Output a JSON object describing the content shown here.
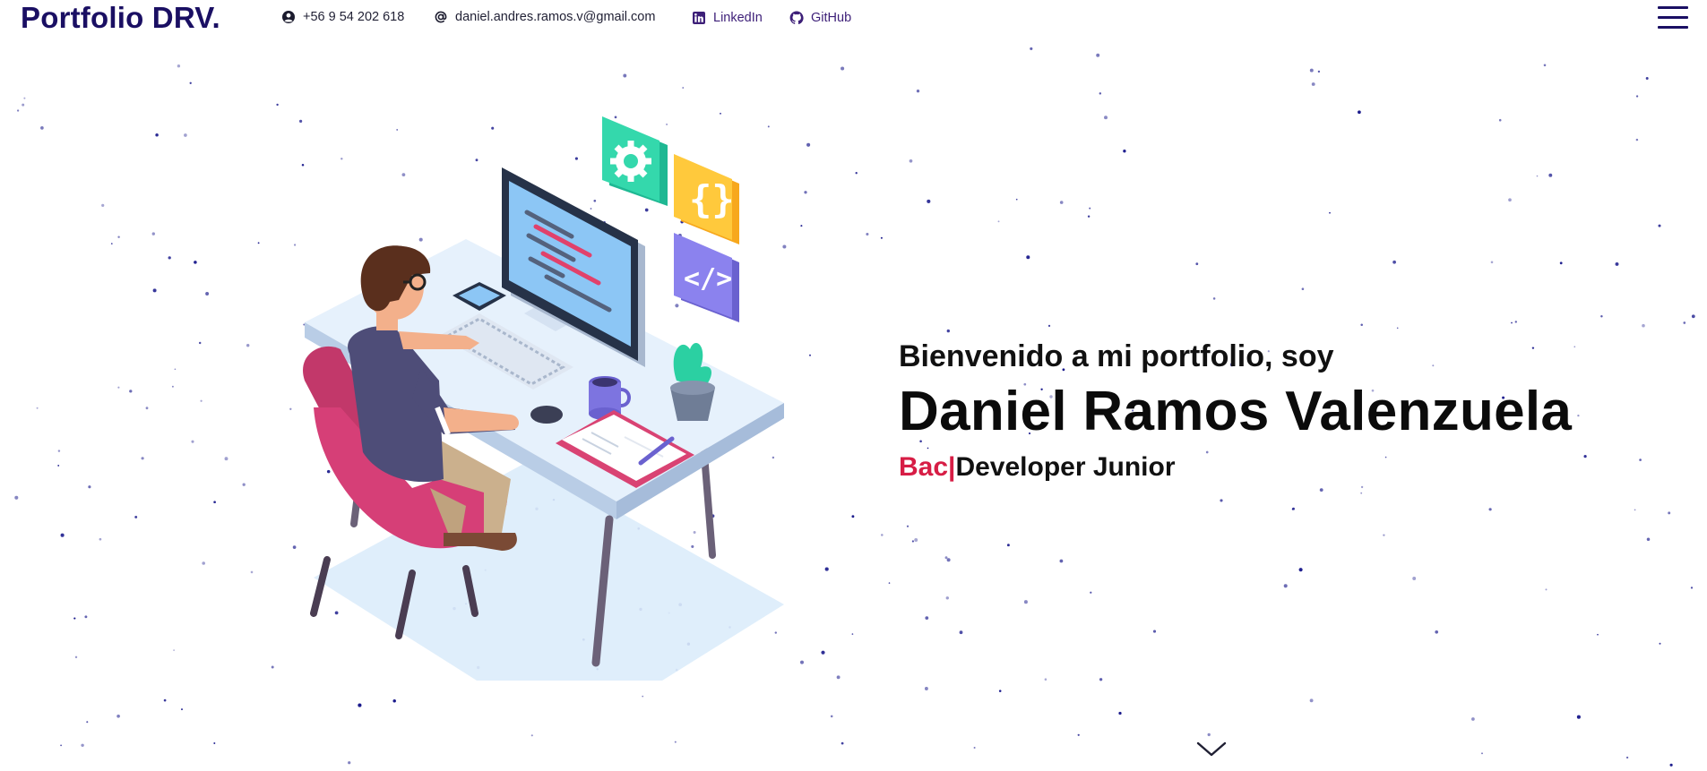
{
  "brand": "Portfolio DRV.",
  "contacts": {
    "phone": {
      "icon": "user-circle-icon",
      "text": "+56 9 54 202 618"
    },
    "email": {
      "icon": "at-sign-icon",
      "text": "daniel.andres.ramos.v@gmail.com"
    },
    "linkedin": {
      "icon": "linkedin-icon",
      "text": "LinkedIn"
    },
    "github": {
      "icon": "github-icon",
      "text": "GitHub"
    }
  },
  "menu_icon": "hamburger-menu-icon",
  "hero": {
    "greeting": "Bienvenido a mi portfolio, soy",
    "name": "Daniel Ramos Valenzuela",
    "typed_text": "Bac",
    "caret": "|",
    "role_suffix": "Developer Junior"
  },
  "scroll_icon": "chevron-down-icon",
  "colors": {
    "brand": "#1a0f63",
    "accent": "#d71d45",
    "text": "#111111",
    "stars": "#1a1a8c"
  }
}
